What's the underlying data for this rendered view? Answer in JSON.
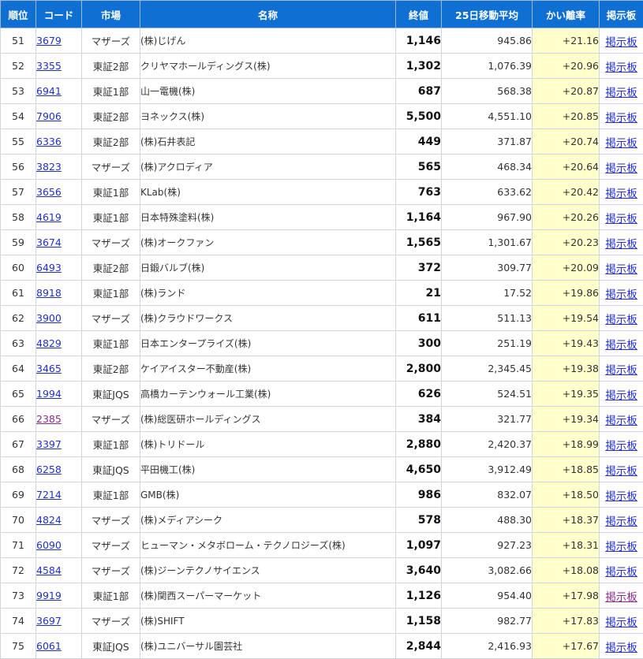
{
  "headers": {
    "rank": "順位",
    "code": "コード",
    "market": "市場",
    "name": "名称",
    "close": "終値",
    "ma25": "25日移動平均",
    "deviation": "かい離率",
    "board": "掲示板"
  },
  "colors": {
    "header_bg": "#0f6fd3",
    "link": "#1f2fcc",
    "visited_link": "#8a2b8a",
    "deviation_bg": "#ffffcc"
  },
  "rows": [
    {
      "rank": "51",
      "code": "3679",
      "market": "マザーズ",
      "name": "(株)じげん",
      "close": "1,146",
      "ma25": "945.86",
      "deviation": "+21.16",
      "board": "掲示板"
    },
    {
      "rank": "52",
      "code": "3355",
      "market": "東証2部",
      "name": "クリヤマホールディングス(株)",
      "close": "1,302",
      "ma25": "1,076.39",
      "deviation": "+20.96",
      "board": "掲示板"
    },
    {
      "rank": "53",
      "code": "6941",
      "market": "東証1部",
      "name": "山一電機(株)",
      "close": "687",
      "ma25": "568.38",
      "deviation": "+20.87",
      "board": "掲示板"
    },
    {
      "rank": "54",
      "code": "7906",
      "market": "東証2部",
      "name": "ヨネックス(株)",
      "close": "5,500",
      "ma25": "4,551.10",
      "deviation": "+20.85",
      "board": "掲示板"
    },
    {
      "rank": "55",
      "code": "6336",
      "market": "東証2部",
      "name": "(株)石井表記",
      "close": "449",
      "ma25": "371.87",
      "deviation": "+20.74",
      "board": "掲示板"
    },
    {
      "rank": "56",
      "code": "3823",
      "market": "マザーズ",
      "name": "(株)アクロディア",
      "close": "565",
      "ma25": "468.34",
      "deviation": "+20.64",
      "board": "掲示板"
    },
    {
      "rank": "57",
      "code": "3656",
      "market": "東証1部",
      "name": "KLab(株)",
      "close": "763",
      "ma25": "633.62",
      "deviation": "+20.42",
      "board": "掲示板"
    },
    {
      "rank": "58",
      "code": "4619",
      "market": "東証1部",
      "name": "日本特殊塗料(株)",
      "close": "1,164",
      "ma25": "967.90",
      "deviation": "+20.26",
      "board": "掲示板"
    },
    {
      "rank": "59",
      "code": "3674",
      "market": "マザーズ",
      "name": "(株)オークファン",
      "close": "1,565",
      "ma25": "1,301.67",
      "deviation": "+20.23",
      "board": "掲示板"
    },
    {
      "rank": "60",
      "code": "6493",
      "market": "東証2部",
      "name": "日鍛バルブ(株)",
      "close": "372",
      "ma25": "309.77",
      "deviation": "+20.09",
      "board": "掲示板"
    },
    {
      "rank": "61",
      "code": "8918",
      "market": "東証1部",
      "name": "(株)ランド",
      "close": "21",
      "ma25": "17.52",
      "deviation": "+19.86",
      "board": "掲示板"
    },
    {
      "rank": "62",
      "code": "3900",
      "market": "マザーズ",
      "name": "(株)クラウドワークス",
      "close": "611",
      "ma25": "511.13",
      "deviation": "+19.54",
      "board": "掲示板"
    },
    {
      "rank": "63",
      "code": "4829",
      "market": "東証1部",
      "name": "日本エンタープライズ(株)",
      "close": "300",
      "ma25": "251.19",
      "deviation": "+19.43",
      "board": "掲示板"
    },
    {
      "rank": "64",
      "code": "3465",
      "market": "東証2部",
      "name": "ケイアイスター不動産(株)",
      "close": "2,800",
      "ma25": "2,345.45",
      "deviation": "+19.38",
      "board": "掲示板"
    },
    {
      "rank": "65",
      "code": "1994",
      "market": "東証JQS",
      "name": "高橋カーテンウォール工業(株)",
      "close": "626",
      "ma25": "524.51",
      "deviation": "+19.35",
      "board": "掲示板"
    },
    {
      "rank": "66",
      "code": "2385",
      "market": "マザーズ",
      "name": "(株)総医研ホールディングス",
      "close": "384",
      "ma25": "321.77",
      "deviation": "+19.34",
      "board": "掲示板",
      "code_visited": true
    },
    {
      "rank": "67",
      "code": "3397",
      "market": "東証1部",
      "name": "(株)トリドール",
      "close": "2,880",
      "ma25": "2,420.37",
      "deviation": "+18.99",
      "board": "掲示板"
    },
    {
      "rank": "68",
      "code": "6258",
      "market": "東証JQS",
      "name": "平田機工(株)",
      "close": "4,650",
      "ma25": "3,912.49",
      "deviation": "+18.85",
      "board": "掲示板"
    },
    {
      "rank": "69",
      "code": "7214",
      "market": "東証1部",
      "name": "GMB(株)",
      "close": "986",
      "ma25": "832.07",
      "deviation": "+18.50",
      "board": "掲示板"
    },
    {
      "rank": "70",
      "code": "4824",
      "market": "マザーズ",
      "name": "(株)メディアシーク",
      "close": "578",
      "ma25": "488.30",
      "deviation": "+18.37",
      "board": "掲示板"
    },
    {
      "rank": "71",
      "code": "6090",
      "market": "マザーズ",
      "name": "ヒューマン・メタボローム・テクノロジーズ(株)",
      "close": "1,097",
      "ma25": "927.23",
      "deviation": "+18.31",
      "board": "掲示板"
    },
    {
      "rank": "72",
      "code": "4584",
      "market": "マザーズ",
      "name": "(株)ジーンテクノサイエンス",
      "close": "3,640",
      "ma25": "3,082.66",
      "deviation": "+18.08",
      "board": "掲示板"
    },
    {
      "rank": "73",
      "code": "9919",
      "market": "東証1部",
      "name": "(株)関西スーパーマーケット",
      "close": "1,126",
      "ma25": "954.40",
      "deviation": "+17.98",
      "board": "掲示板",
      "board_visited": true
    },
    {
      "rank": "74",
      "code": "3697",
      "market": "マザーズ",
      "name": "(株)SHIFT",
      "close": "1,158",
      "ma25": "982.77",
      "deviation": "+17.83",
      "board": "掲示板"
    },
    {
      "rank": "75",
      "code": "6061",
      "market": "東証JQS",
      "name": "(株)ユニバーサル園芸社",
      "close": "2,844",
      "ma25": "2,416.93",
      "deviation": "+17.67",
      "board": "掲示板"
    }
  ]
}
